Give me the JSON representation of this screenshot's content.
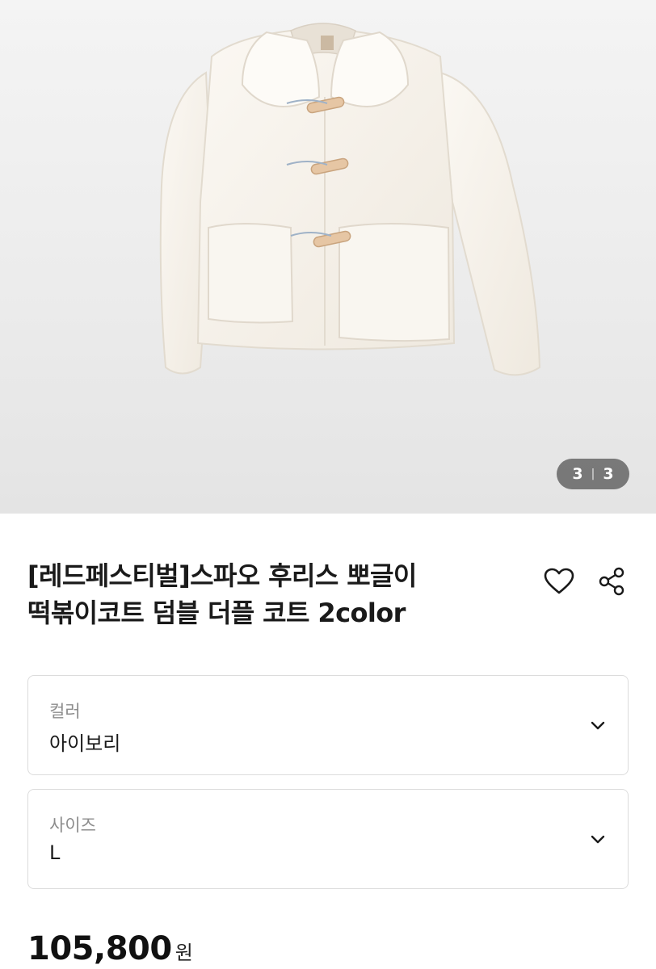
{
  "gallery": {
    "current": "3",
    "separator": "|",
    "total": "3",
    "image_subject": "ivory fleece duffle coat product photo"
  },
  "product": {
    "title_line1": "[레드페스티벌]스파오 후리스 뽀글이",
    "title_line2": "떡볶이코트 덤블 더플 코트 2color",
    "wishlist_icon": "heart-outline-icon",
    "share_icon": "share-icon"
  },
  "options": {
    "color": {
      "label": "컬러",
      "value": "아이보리"
    },
    "size": {
      "label": "사이즈",
      "value": "L"
    }
  },
  "price": {
    "amount": "105,800",
    "unit": "원"
  },
  "colors": {
    "coat": "#f7f3ec",
    "toggle": "#e6c6a4",
    "pager_bg": "#5a5a5a"
  }
}
